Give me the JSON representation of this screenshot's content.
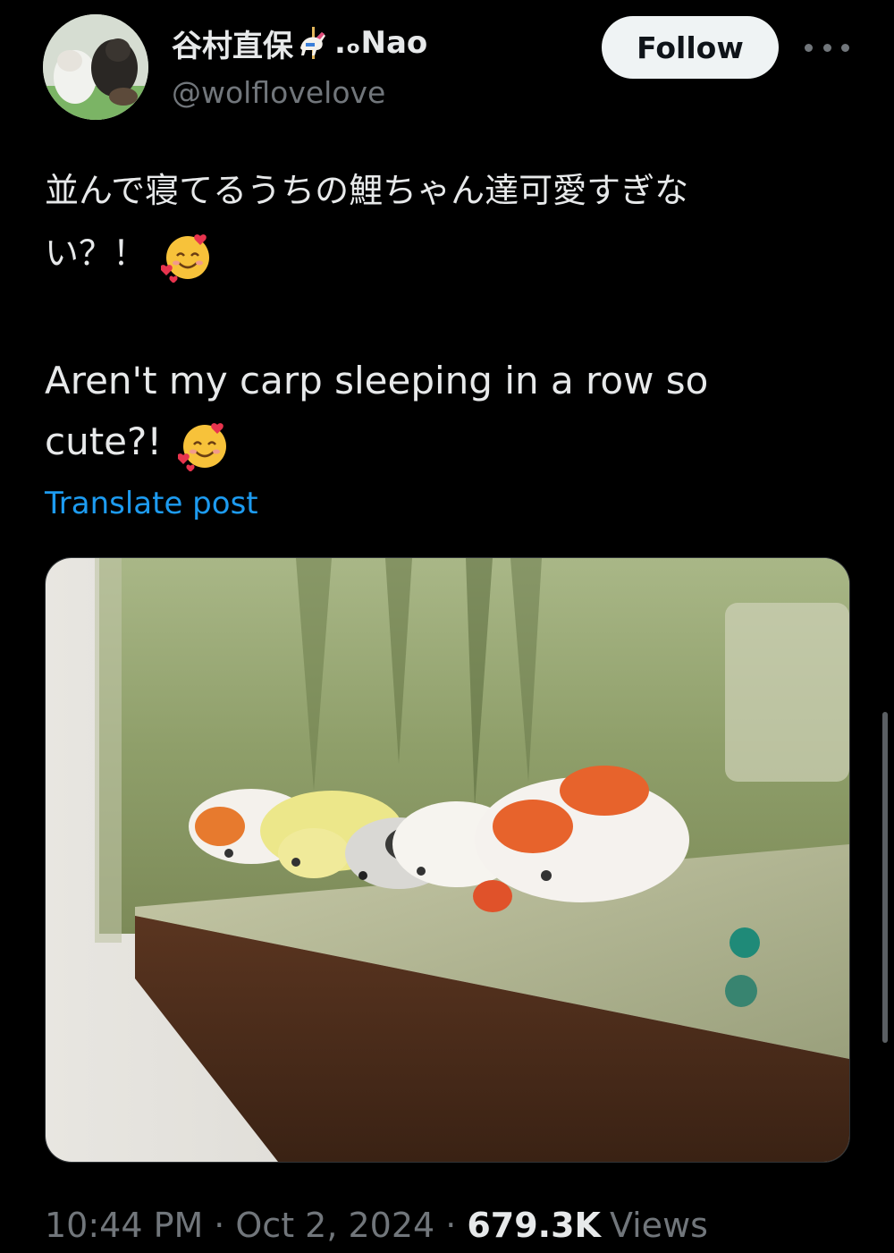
{
  "author": {
    "display_name_prefix": "谷村直保",
    "display_name_suffix": ".ₒNao",
    "handle": "@wolflovelove",
    "avatar_icon": "avatar-dogs-photo",
    "name_icon": "carousel-horse-icon"
  },
  "actions": {
    "follow_label": "Follow",
    "more_icon": "more-options-icon"
  },
  "post": {
    "text_jp_line1": "並んで寝てるうちの鯉ちゃん達可愛すぎな",
    "text_jp_line2": "い？！",
    "text_en_line1": "Aren't my carp sleeping in a row so",
    "text_en_line2": "cute?!",
    "emoji": "smiling-face-with-hearts-emoji",
    "translate_label": "Translate post",
    "media_description_icon": "koi-aquarium-photo"
  },
  "meta": {
    "time": "10:44 PM",
    "date": "Oct 2, 2024",
    "separator": "·",
    "views_count": "679.3K",
    "views_label": "Views"
  },
  "colors": {
    "background": "#000000",
    "text_primary": "#e7e9ea",
    "text_secondary": "#71767b",
    "link": "#1d9bf0",
    "follow_bg": "#eff3f4"
  }
}
